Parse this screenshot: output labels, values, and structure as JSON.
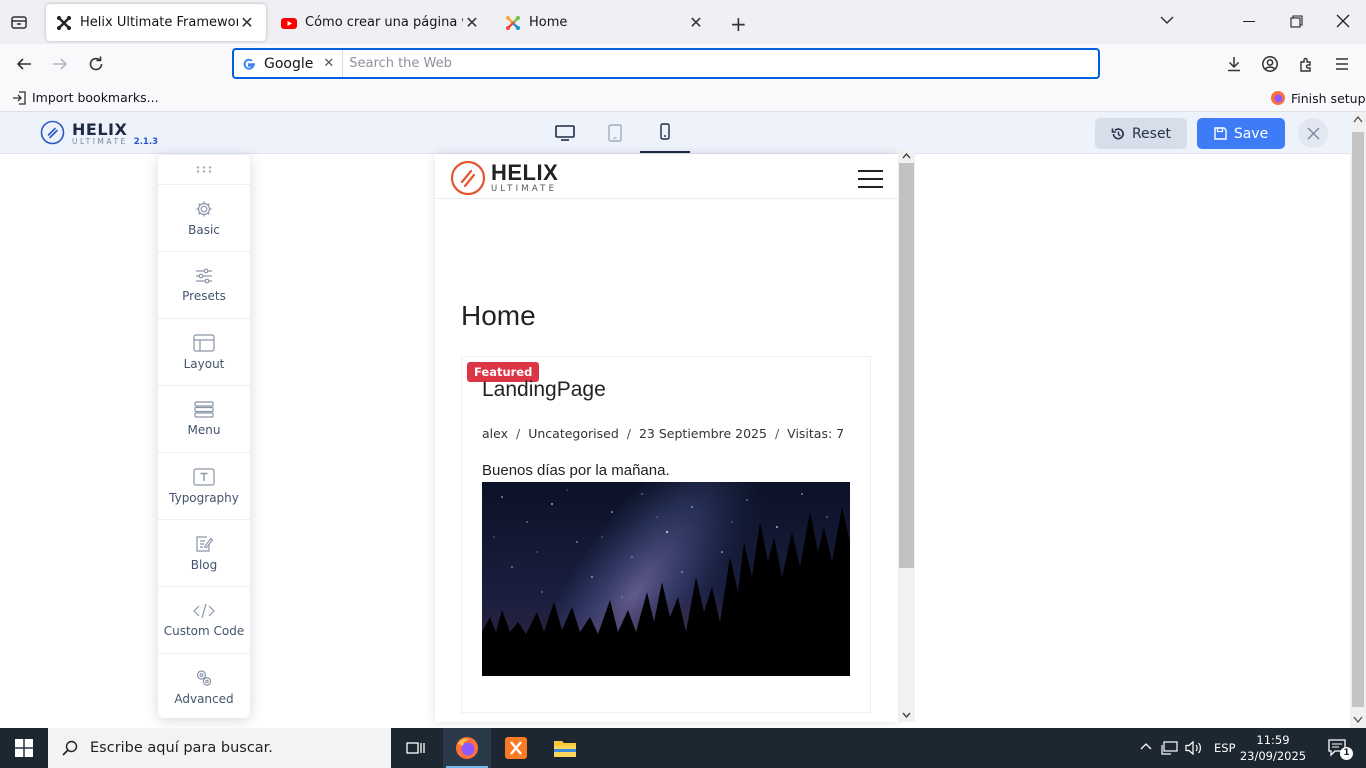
{
  "browser": {
    "tabs": [
      {
        "title": "Helix Ultimate Framework",
        "icon": "joomla-icon",
        "active": true
      },
      {
        "title": "Cómo crear una página web co",
        "icon": "youtube-icon",
        "active": false
      },
      {
        "title": "Home",
        "icon": "joomla-icon",
        "active": false
      }
    ],
    "search_engine": "Google",
    "search_placeholder": "Search the Web",
    "import_bookmarks": "Import bookmarks...",
    "finish_setup": "Finish setup"
  },
  "helix": {
    "logo_text": "HELIX",
    "logo_sub": "ULTIMATE",
    "version": "2.1.3",
    "reset_label": "Reset",
    "save_label": "Save",
    "active_device": "mobile",
    "sidebar": [
      {
        "label": "Basic",
        "icon": "gear-icon"
      },
      {
        "label": "Presets",
        "icon": "sliders-icon"
      },
      {
        "label": "Layout",
        "icon": "layout-icon"
      },
      {
        "label": "Menu",
        "icon": "menu-list-icon"
      },
      {
        "label": "Typography",
        "icon": "typography-icon"
      },
      {
        "label": "Blog",
        "icon": "blog-icon"
      },
      {
        "label": "Custom Code",
        "icon": "code-icon"
      },
      {
        "label": "Advanced",
        "icon": "advanced-icon"
      }
    ]
  },
  "preview": {
    "site_logo_text": "HELIX",
    "site_logo_sub": "ULTIMATE",
    "page_title": "Home",
    "article": {
      "badge": "Featured",
      "title": "LandingPage",
      "author": "alex",
      "category": "Uncategorised",
      "date": "23 Septiembre 2025",
      "hits": "Visitas: 7",
      "intro": "Buenos días por la mañana."
    }
  },
  "taskbar": {
    "search_placeholder": "Escribe aquí para buscar.",
    "language": "ESP",
    "time": "11:59",
    "date": "23/09/2025",
    "notifications": "1"
  }
}
